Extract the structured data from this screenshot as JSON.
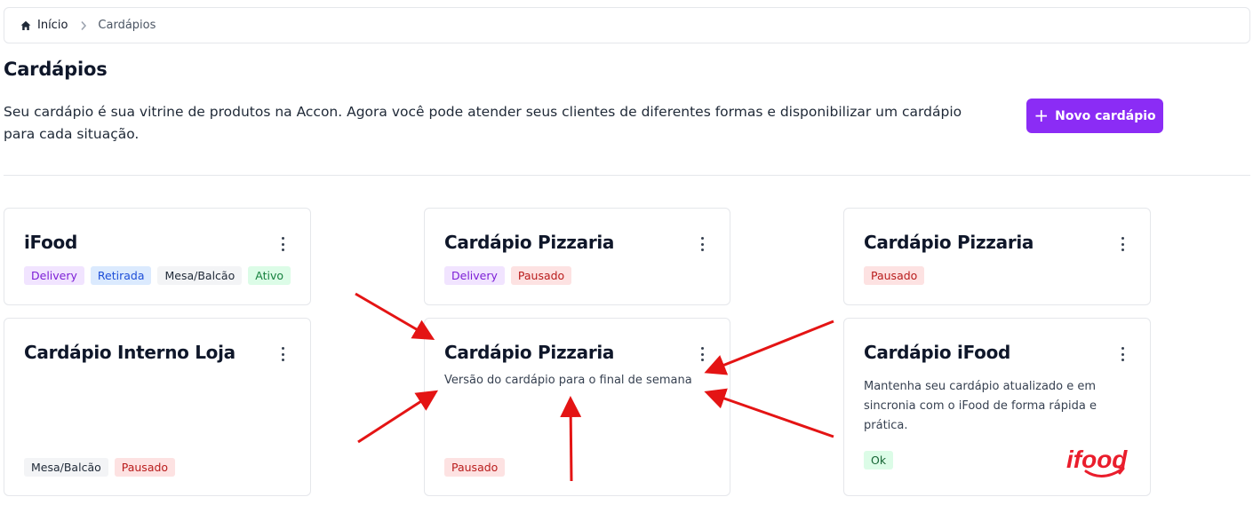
{
  "breadcrumb": {
    "home_label": "Início",
    "current_label": "Cardápios"
  },
  "page": {
    "title": "Cardápios",
    "description": "Seu cardápio é sua vitrine de produtos na Accon. Agora você pode atender seus clientes de diferentes formas e disponibilizar um cardápio para cada situação.",
    "new_button_label": "Novo cardápio"
  },
  "cards": [
    {
      "title": "iFood",
      "tags": [
        "Delivery",
        "Retirada",
        "Mesa/Balcão",
        "Ativo"
      ]
    },
    {
      "title": "Cardápio Pizzaria",
      "tags": [
        "Delivery",
        "Pausado"
      ]
    },
    {
      "title": "Cardápio Pizzaria",
      "tags": [
        "Pausado"
      ]
    },
    {
      "title": "Cardápio Interno Loja",
      "tags": [
        "Mesa/Balcão",
        "Pausado"
      ]
    },
    {
      "title": "Cardápio Pizzaria",
      "description": "Versão do cardápio para o final de semana",
      "tags": [
        "Pausado"
      ]
    },
    {
      "title": "Cardápio iFood",
      "description": "Mantenha seu cardápio atualizado e em sincronia com o iFood de forma rápida e prática.",
      "tags": [
        "Ok"
      ],
      "logo_text": "ifood"
    }
  ],
  "colors": {
    "accent": "#8b2cf5",
    "annotation_arrow": "#e41414",
    "ifood_red": "#ea1d2c"
  },
  "icons": {
    "home": "home-icon",
    "separator": "chevron-right-icon",
    "add": "plus-icon",
    "menu": "kebab-menu-icon"
  }
}
